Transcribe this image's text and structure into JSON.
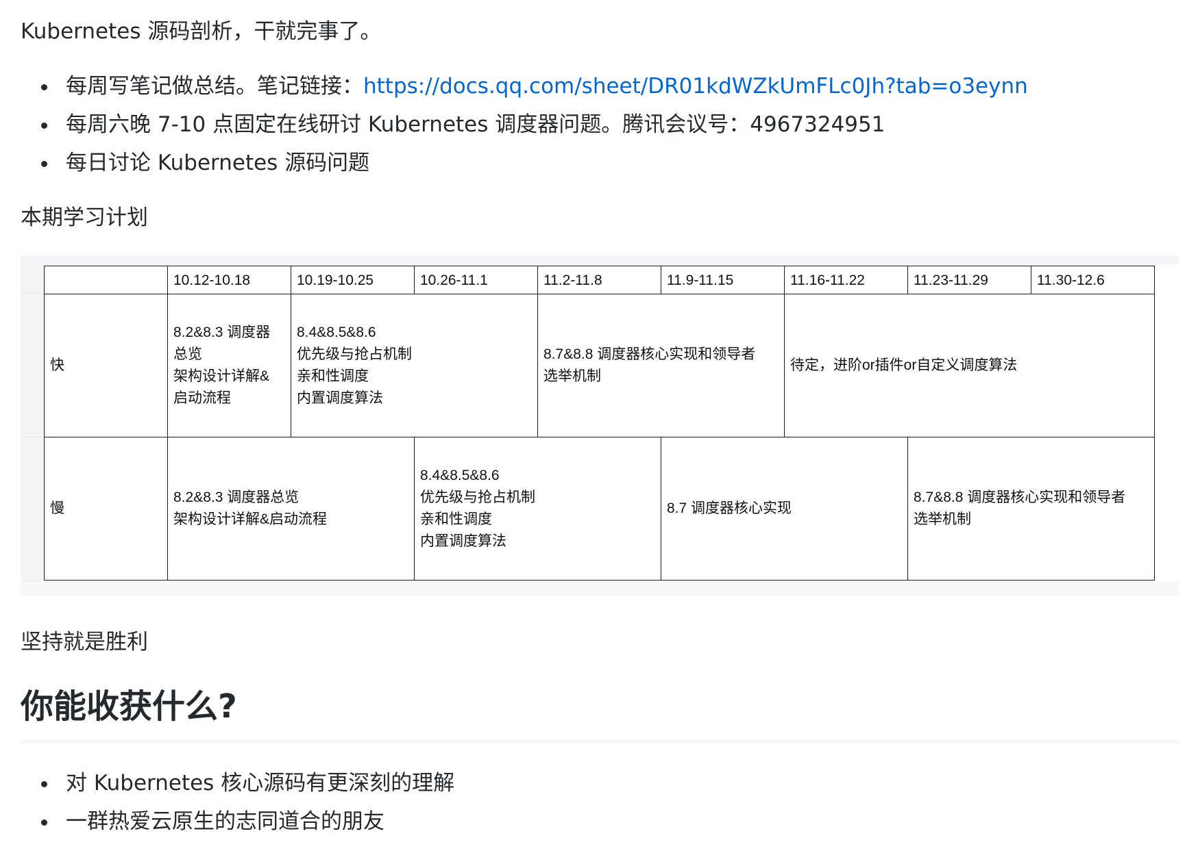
{
  "intro": "Kubernetes 源码剖析，干就完事了。",
  "bullets_top": [
    {
      "text": "每周写笔记做总结。笔记链接：",
      "link": "https://docs.qq.com/sheet/DR01kdWZkUmFLc0Jh?tab=o3eynn"
    },
    {
      "text": "每周六晚 7-10 点固定在线研讨 Kubernetes 调度器问题。腾讯会议号：4967324951",
      "link": ""
    },
    {
      "text": "每日讨论 Kubernetes 源码问题",
      "link": ""
    }
  ],
  "plan_title": "本期学习计划",
  "schedule": {
    "weeks": [
      "10.12-10.18",
      "10.19-10.25",
      "10.26-11.1",
      "11.2-11.8",
      "11.9-11.15",
      "11.16-11.22",
      "11.23-11.29",
      "11.30-12.6"
    ],
    "rows": [
      {
        "label": "快",
        "cells": [
          {
            "text": "8.2&8.3 调度器\n总览\n架构设计详解&\n启动流程",
            "span": 1
          },
          {
            "text": "8.4&8.5&8.6\n优先级与抢占机制\n亲和性调度\n内置调度算法",
            "span": 2
          },
          {
            "text": "8.7&8.8 调度器核心实现和领导者\n选举机制",
            "span": 2
          },
          {
            "text": "待定，进阶or插件or自定义调度算法",
            "span": 3
          }
        ]
      },
      {
        "label": "慢",
        "cells": [
          {
            "text": "8.2&8.3 调度器总览\n架构设计详解&启动流程",
            "span": 2
          },
          {
            "text": "8.4&8.5&8.6\n优先级与抢占机制\n亲和性调度\n内置调度算法",
            "span": 2
          },
          {
            "text": "8.7 调度器核心实现",
            "span": 2
          },
          {
            "text": "8.7&8.8 调度器核心实现和领导者\n选举机制",
            "span": 2
          }
        ]
      }
    ]
  },
  "motto": "坚持就是胜利",
  "section_title": "你能收获什么?",
  "bullets_bottom": [
    {
      "text": "对 Kubernetes 核心源码有更深刻的理解"
    },
    {
      "text": "一群热爱云原生的志同道合的朋友"
    }
  ]
}
